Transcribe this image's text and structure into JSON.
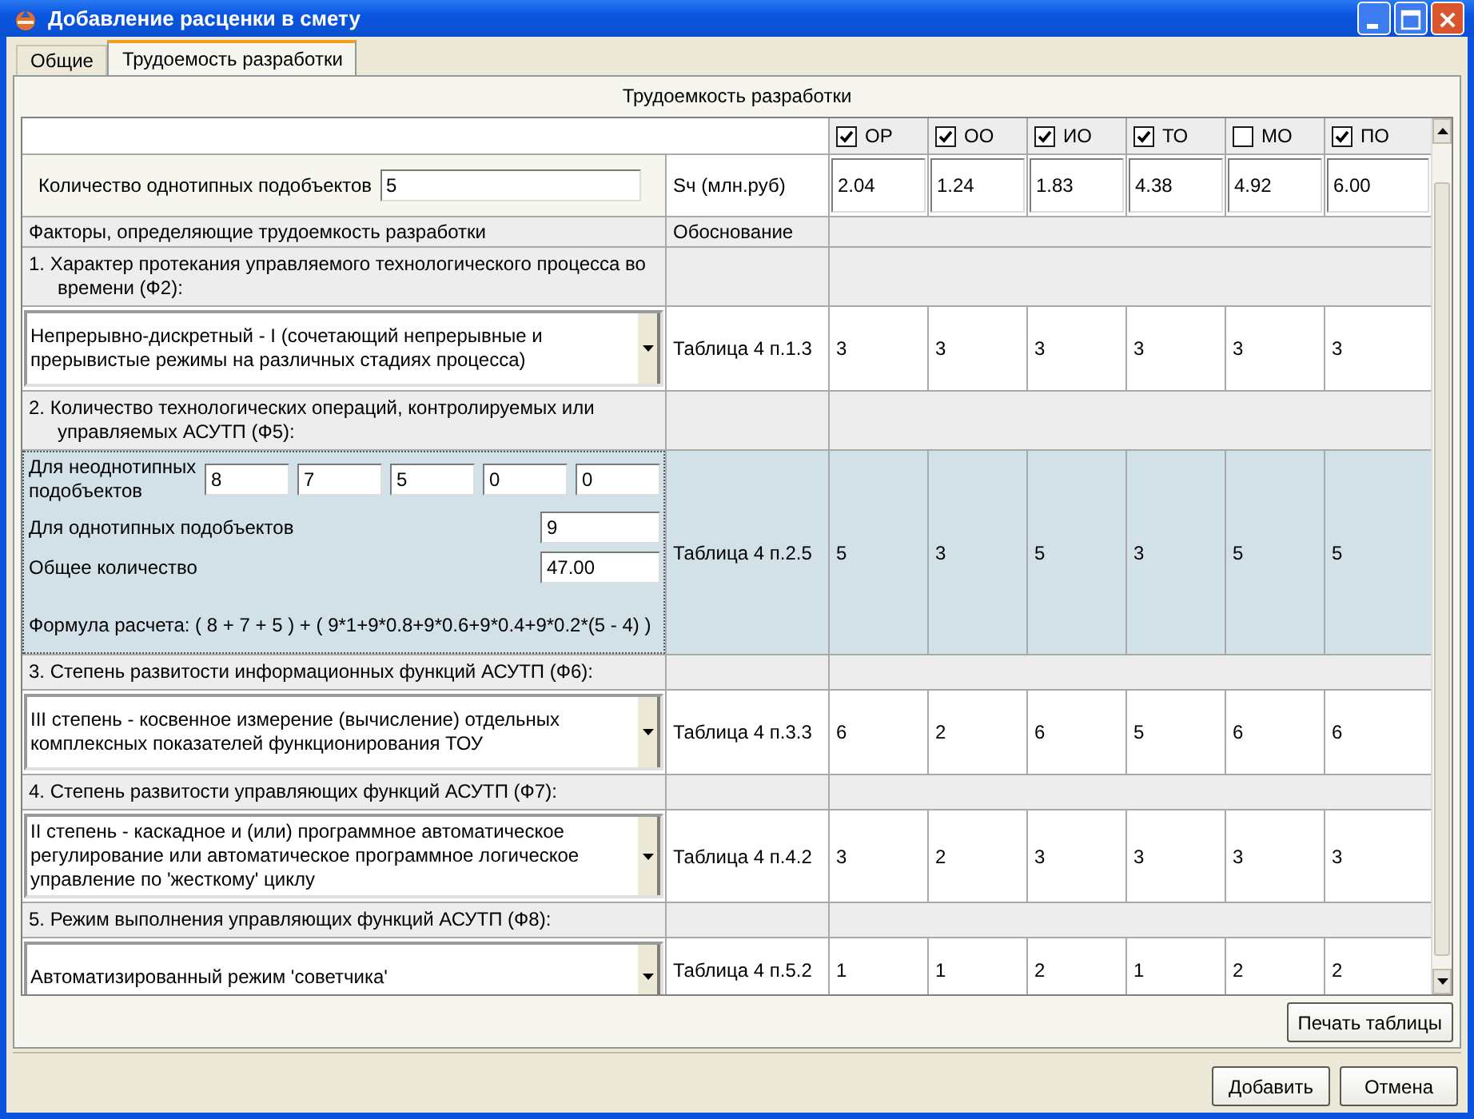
{
  "window": {
    "title": "Добавление расценки в смету"
  },
  "tabs": [
    {
      "label": "Общие",
      "selected": false
    },
    {
      "label": "Трудоемость разработки",
      "selected": true
    }
  ],
  "section_title": "Трудоемкость разработки",
  "columns": [
    {
      "label": "ОР",
      "checked": true
    },
    {
      "label": "ОО",
      "checked": true
    },
    {
      "label": "ИО",
      "checked": true
    },
    {
      "label": "ТО",
      "checked": true
    },
    {
      "label": "МО",
      "checked": false
    },
    {
      "label": "ПО",
      "checked": true
    }
  ],
  "count": {
    "label": "Количество однотипных подобъектов",
    "value": "5"
  },
  "sv": {
    "label": "Sч (млн.руб)",
    "values": [
      "2.04",
      "1.24",
      "1.83",
      "4.38",
      "4.92",
      "6.00"
    ]
  },
  "factors_header": {
    "label": "Факторы, определяющие трудоемкость разработки",
    "basis_label": "Обоснование"
  },
  "factors": [
    {
      "kind": "select",
      "title": "1. Характер протекания управляемого технологического процесса во времени (Ф2):",
      "value": "Непрерывно-дискретный - I (сочетающий непрерывные и прерывистые режимы на различных стадиях процесса)",
      "basis": "Таблица 4 п.1.3",
      "scores": [
        "3",
        "3",
        "3",
        "3",
        "3",
        "3"
      ]
    },
    {
      "kind": "quantity",
      "title": "2. Количество технологических операций, контролируемых или управляемых АСУТП (Ф5):",
      "nonuniform_label": "Для неоднотипных подобъектов",
      "nonuniform_values": [
        "8",
        "7",
        "5",
        "0",
        "0"
      ],
      "uniform_label": "Для однотипных подобъектов",
      "uniform_value": "9",
      "total_label": "Общее количество",
      "total_value": "47.00",
      "formula": "Формула расчета: ( 8 + 7 + 5 ) + ( 9*1+9*0.8+9*0.6+9*0.4+9*0.2*(5 - 4) )",
      "basis": "Таблица 4 п.2.5",
      "scores": [
        "5",
        "3",
        "5",
        "3",
        "5",
        "5"
      ]
    },
    {
      "kind": "select",
      "title": "3. Степень развитости информационных функций АСУТП (Ф6):",
      "value": "III степень - косвенное измерение (вычисление) отдельных комплексных показателей функционирования ТОУ",
      "basis": "Таблица 4 п.3.3",
      "scores": [
        "6",
        "2",
        "6",
        "5",
        "6",
        "6"
      ]
    },
    {
      "kind": "select",
      "title": "4. Степень развитости управляющих функций АСУТП (Ф7):",
      "value": "II степень - каскадное и (или) программное автоматическое регулирование или автоматическое программное логическое управление по 'жесткому' циклу",
      "basis": "Таблица 4 п.4.2",
      "scores": [
        "3",
        "2",
        "3",
        "3",
        "3",
        "3"
      ]
    },
    {
      "kind": "select",
      "title": "5. Режим выполнения управляющих функций АСУТП (Ф8):",
      "value": "Автоматизированный режим 'советчика'",
      "basis": "Таблица 4 п.5.2",
      "scores": [
        "1",
        "1",
        "2",
        "1",
        "2",
        "2"
      ]
    }
  ],
  "print_button": "Печать таблицы",
  "buttons": [
    "Добавить",
    "Отмена"
  ]
}
